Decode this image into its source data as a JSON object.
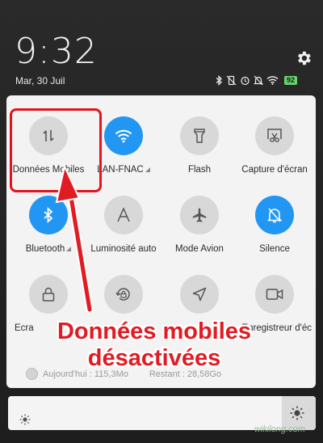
{
  "status_bar": {
    "time": "9:32",
    "date": "Mar, 30 Juil",
    "battery_level": "92",
    "icons": [
      "bluetooth-icon",
      "vibrate-off-icon",
      "alarm-icon",
      "silent-icon",
      "wifi-icon",
      "battery-icon"
    ]
  },
  "quick_settings": {
    "tiles": [
      {
        "label": "Données Mobiles",
        "icon": "mobile-data-icon",
        "state": "off",
        "has_caret": true
      },
      {
        "label": "LAN-FNAC",
        "icon": "wifi-icon",
        "state": "on",
        "has_caret": true
      },
      {
        "label": "Flash",
        "icon": "flashlight-icon",
        "state": "off",
        "has_caret": false
      },
      {
        "label": "Capture d'écran",
        "icon": "screenshot-icon",
        "state": "off",
        "has_caret": false
      },
      {
        "label": "Bluetooth",
        "icon": "bluetooth-icon",
        "state": "on",
        "has_caret": true
      },
      {
        "label": "Luminosité auto",
        "icon": "auto-brightness-icon",
        "state": "off",
        "has_caret": false
      },
      {
        "label": "Mode Avion",
        "icon": "airplane-icon",
        "state": "off",
        "has_caret": false
      },
      {
        "label": "Silence",
        "icon": "silence-icon",
        "state": "on",
        "has_caret": false
      },
      {
        "label": "Écra",
        "icon": "lock-icon",
        "state": "off",
        "has_caret": false
      },
      {
        "label": "",
        "icon": "rotation-lock-icon",
        "state": "off",
        "has_caret": false
      },
      {
        "label": "",
        "icon": "location-icon",
        "state": "off",
        "has_caret": false
      },
      {
        "label": "Enregistreur d'éc",
        "icon": "screen-recorder-icon",
        "state": "off",
        "has_caret": false
      }
    ]
  },
  "data_usage": {
    "today": "Aujourd'hui : 115,3Mo",
    "remaining": "Restant : 28,58Go"
  },
  "brightness": {
    "level": 1.0
  },
  "annotation": {
    "line1": "Données mobiles",
    "line2": "désactivées"
  },
  "watermark": "wikilong.com",
  "colors": {
    "accent": "#2196f3",
    "annotation_red": "#e11b22",
    "battery": "#63d36b"
  }
}
